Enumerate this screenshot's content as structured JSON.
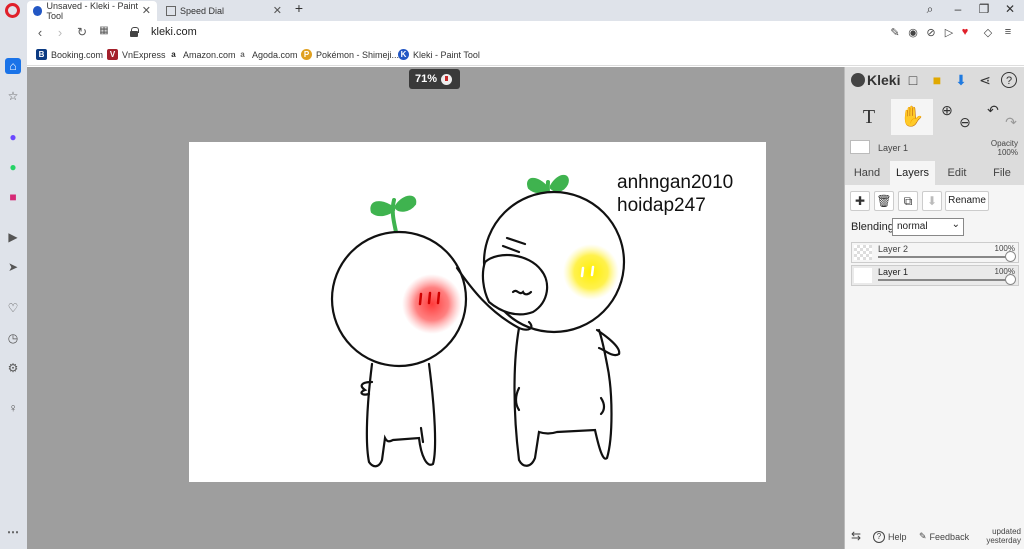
{
  "browser": {
    "tabs": [
      {
        "label": "Unsaved - Kleki - Paint Tool",
        "active": true
      },
      {
        "label": "Speed Dial",
        "active": false
      }
    ],
    "url": "kleki.com",
    "bookmarks": [
      {
        "label": "Booking.com",
        "icon": "B",
        "color": "#0b3a82"
      },
      {
        "label": "VnExpress",
        "icon": "V",
        "color": "#a4202b"
      },
      {
        "label": "Amazon.com",
        "icon": "a",
        "color": "#222222"
      },
      {
        "label": "Agoda.com",
        "icon": "a",
        "color": "#666666"
      },
      {
        "label": "Pokémon - Shimeji...",
        "icon": "P",
        "color": "#e0a020"
      },
      {
        "label": "Kleki - Paint Tool",
        "icon": "K",
        "color": "#2357c4"
      }
    ]
  },
  "canvas": {
    "zoom": "71%",
    "drawing_text": [
      "anhngan2010",
      "hoidap247"
    ]
  },
  "panel": {
    "app_name": "Kleki",
    "top_layer_name": "Layer 1",
    "opacity_label": "Opacity",
    "opacity_value": "100%",
    "tabs": [
      "Hand",
      "Layers",
      "Edit",
      "File"
    ],
    "active_tab": "Layers",
    "rename_label": "Rename",
    "blending_label": "Blending",
    "blending_value": "normal",
    "layers": [
      {
        "name": "Layer 2",
        "opacity": "100%",
        "opacity_fraction": 1.0
      },
      {
        "name": "Layer 1",
        "opacity": "100%",
        "opacity_fraction": 1.0
      }
    ],
    "footer": {
      "help": "Help",
      "feedback": "Feedback",
      "updated_line1": "updated",
      "updated_line2": "yesterday"
    }
  }
}
